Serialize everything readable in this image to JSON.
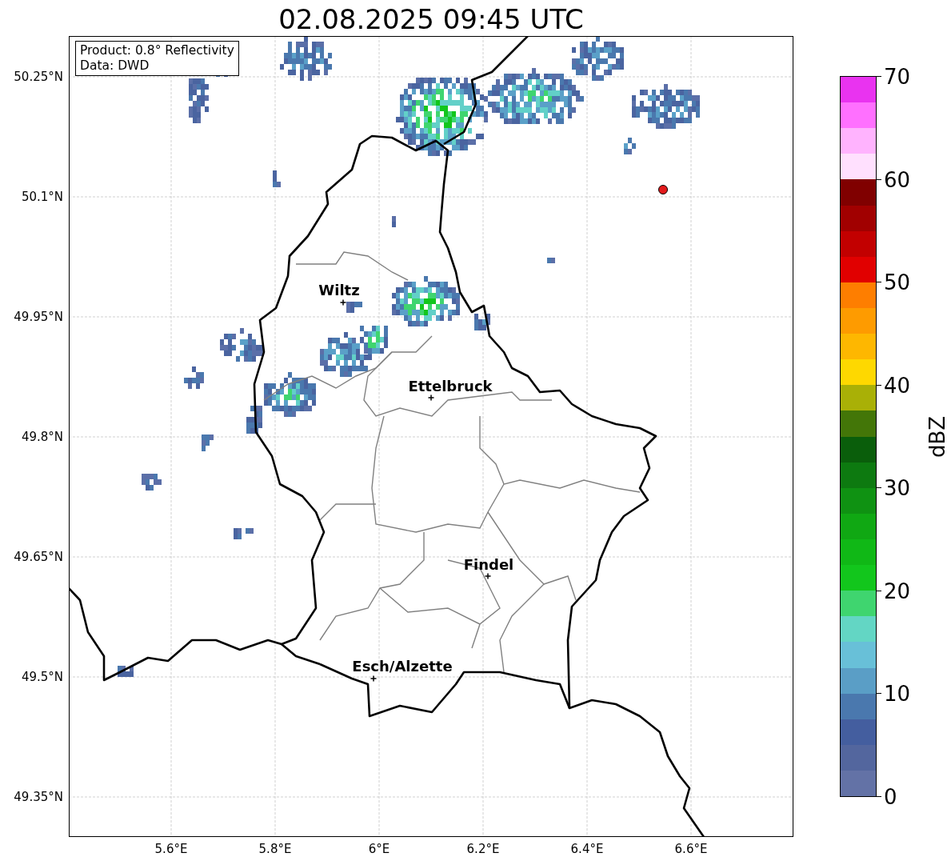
{
  "title": "02.08.2025 09:45 UTC",
  "info_box": {
    "lines": [
      "Product: 0.8° Reflectivity",
      "Data: DWD"
    ]
  },
  "map": {
    "x_ticks": [
      "5.6°E",
      "5.8°E",
      "6°E",
      "6.2°E",
      "6.4°E",
      "6.6°E"
    ],
    "y_ticks": [
      "50.25°N",
      "50.1°N",
      "49.95°N",
      "49.8°N",
      "49.65°N",
      "49.5°N",
      "49.35°N"
    ],
    "cities": [
      {
        "name": "Wiltz"
      },
      {
        "name": "Ettelbruck"
      },
      {
        "name": "Findel"
      },
      {
        "name": "Esch/Alzette"
      }
    ]
  },
  "colorbar": {
    "label": "dBZ",
    "ticks": [
      "70",
      "60",
      "50",
      "40",
      "30",
      "20",
      "10",
      "0"
    ],
    "bands": [
      {
        "color": "#e933f0"
      },
      {
        "color": "#ff70ff"
      },
      {
        "color": "#ffb3fe"
      },
      {
        "color": "#ffe0fe"
      },
      {
        "color": "#800000"
      },
      {
        "color": "#a10000"
      },
      {
        "color": "#c20000"
      },
      {
        "color": "#e10000"
      },
      {
        "color": "#fe7e00"
      },
      {
        "color": "#fe9b00"
      },
      {
        "color": "#feb700"
      },
      {
        "color": "#fed800"
      },
      {
        "color": "#a9b006"
      },
      {
        "color": "#437608"
      },
      {
        "color": "#0a5e0b"
      },
      {
        "color": "#0d7a10"
      },
      {
        "color": "#0f9212"
      },
      {
        "color": "#10a813"
      },
      {
        "color": "#10b816"
      },
      {
        "color": "#12c61c"
      },
      {
        "color": "#3fd56f"
      },
      {
        "color": "#63d6c4"
      },
      {
        "color": "#68c0d8"
      },
      {
        "color": "#5a9ec6"
      },
      {
        "color": "#4a78ae"
      },
      {
        "color": "#445e9f"
      },
      {
        "color": "#53669e"
      },
      {
        "color": "#6372a6"
      }
    ]
  }
}
